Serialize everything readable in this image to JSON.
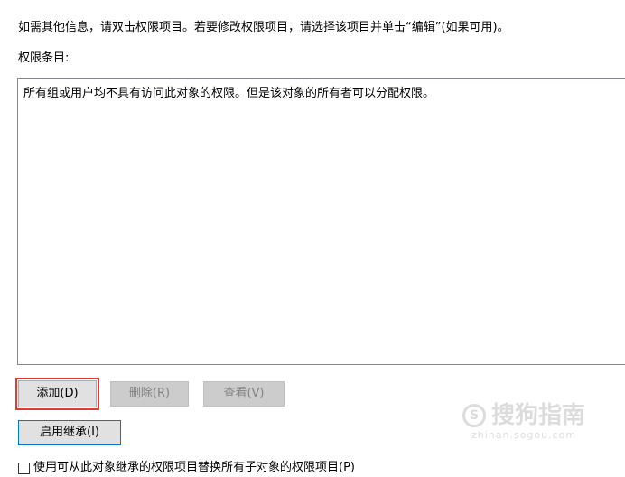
{
  "info_text": "如需其他信息，请双击权限项目。若要修改权限项目，请选择该项目并单击“编辑”(如果可用)。",
  "entries": {
    "label": "权限条目:",
    "message": "所有组或用户均不具有访问此对象的权限。但是该对象的所有者可以分配权限。"
  },
  "buttons": {
    "add": "添加(D)",
    "remove": "删除(R)",
    "view": "查看(V)",
    "enable_inheritance": "启用继承(I)"
  },
  "checkbox": {
    "label": "使用可从此对象继承的权限项目替换所有子对象的权限项目(P)",
    "checked": false
  },
  "watermark": {
    "main": "搜狗指南",
    "url": "zhinan.sogou.com"
  },
  "colors": {
    "highlight": "#e53935",
    "focus": "#0078d7"
  }
}
